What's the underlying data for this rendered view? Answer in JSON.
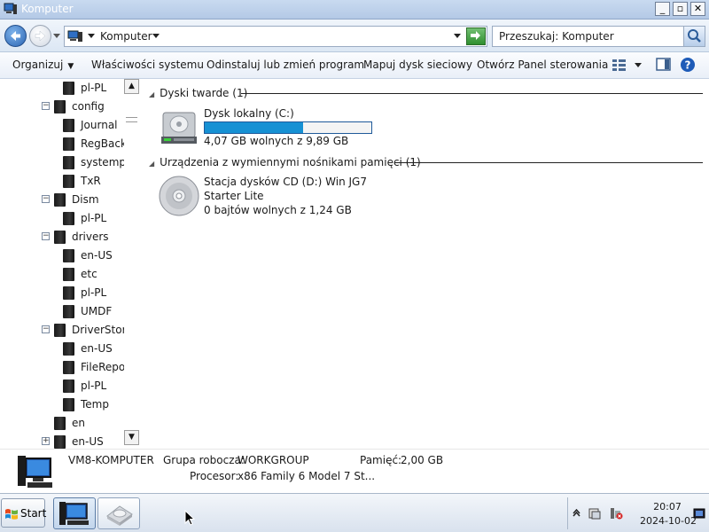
{
  "window": {
    "title": "Komputer"
  },
  "address_bar": {
    "crumb": "Komputer"
  },
  "search": {
    "placeholder": "Przeszukaj: Komputer"
  },
  "command_bar": {
    "organize": "Organizuj",
    "system_properties": "Właściwości systemu",
    "uninstall": "Odinstaluj lub zmień program",
    "map_drive": "Mapuj dysk sieciowy",
    "control_panel": "Otwórz Panel sterowania"
  },
  "tree": {
    "items": [
      {
        "label": "pl-PL",
        "expander": ""
      },
      {
        "label": "config",
        "expander": "−"
      },
      {
        "label": "Journal",
        "expander": ""
      },
      {
        "label": "RegBack",
        "expander": ""
      },
      {
        "label": "systempr",
        "expander": ""
      },
      {
        "label": "TxR",
        "expander": ""
      },
      {
        "label": "Dism",
        "expander": "−"
      },
      {
        "label": "pl-PL",
        "expander": ""
      },
      {
        "label": "drivers",
        "expander": "−"
      },
      {
        "label": "en-US",
        "expander": ""
      },
      {
        "label": "etc",
        "expander": ""
      },
      {
        "label": "pl-PL",
        "expander": ""
      },
      {
        "label": "UMDF",
        "expander": ""
      },
      {
        "label": "DriverStore",
        "expander": "−"
      },
      {
        "label": "en-US",
        "expander": ""
      },
      {
        "label": "FileRepos",
        "expander": ""
      },
      {
        "label": "pl-PL",
        "expander": ""
      },
      {
        "label": "Temp",
        "expander": ""
      },
      {
        "label": "en",
        "expander": ""
      },
      {
        "label": "en-US",
        "expander": "+"
      }
    ]
  },
  "main": {
    "hard_drives_header": "Dyski twarde (1)",
    "local_disk": {
      "name": "Dysk lokalny (C:)",
      "free_text": "4,07 GB wolnych z 9,89 GB",
      "used_fraction": 0.59
    },
    "removable_header": "Urządzenia z wymiennymi nośnikami pamięci (1)",
    "cd_drive": {
      "name_line1": "Stacja dysków CD (D:) Win JG7",
      "name_line2": "Starter Lite",
      "free_text": "0 bajtów wolnych z 1,24 GB"
    }
  },
  "details": {
    "computer_name": "VM8-KOMPUTER",
    "workgroup_label": "Grupa robocza:",
    "workgroup_value": "WORKGROUP",
    "memory_label": "Pamięć:",
    "memory_value": "2,00 GB",
    "processor_label": "Procesor:",
    "processor_value": "x86 Family 6 Model 7 St..."
  },
  "taskbar": {
    "start_label": "Start",
    "clock_time": "20:07",
    "clock_date": "2024-10-02"
  },
  "colors": {
    "capacity_fill": "#1691d4",
    "titlebar": "#b4c9e6"
  }
}
